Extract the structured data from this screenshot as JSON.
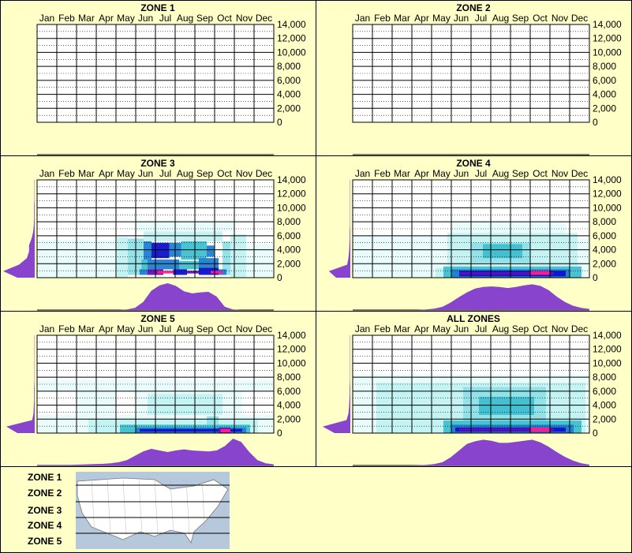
{
  "chart_data": {
    "type": "heatmap",
    "months": [
      "Jan",
      "Feb",
      "Mar",
      "Apr",
      "May",
      "Jun",
      "Jul",
      "Aug",
      "Sep",
      "Oct",
      "Nov",
      "Dec"
    ],
    "y_ticks": [
      "14,000",
      "12,000",
      "10,000",
      "8,000",
      "6,000",
      "4,000",
      "2,000",
      "0"
    ],
    "ylim": [
      0,
      14000
    ],
    "colors": {
      "background": "#ffffc8",
      "plot": "#ffffff",
      "frame": "#000000",
      "marginal": "#8844cc",
      "heat_levels": [
        "#e8fbfb",
        "#c2f2f2",
        "#8fe0e8",
        "#3fbfcf",
        "#1f7fd0",
        "#1010cc",
        "#6010b0",
        "#ff2090"
      ]
    },
    "panels": [
      {
        "title": "ZONE 1",
        "has_data": false,
        "x_marginal": [],
        "y_marginal": [],
        "cells": []
      },
      {
        "title": "ZONE 2",
        "has_data": false,
        "x_marginal": [],
        "y_marginal": [],
        "cells": []
      },
      {
        "title": "ZONE 3",
        "has_data": true,
        "x_marginal": [
          0,
          0,
          0,
          0,
          0,
          0,
          0,
          0,
          0,
          0,
          0,
          0.02,
          0.08,
          0.3,
          0.72,
          0.92,
          1.0,
          0.9,
          0.7,
          0.62,
          0.66,
          0.68,
          0.5,
          0.12,
          0.02,
          0,
          0,
          0,
          0,
          0
        ],
        "y_marginal": [
          0.55,
          1.0,
          0.5,
          0.25,
          0.18,
          0.18,
          0.1,
          0.05,
          0.03,
          0.02,
          0.02,
          0.02,
          0.01,
          0.01,
          0.01,
          0.01
        ],
        "cells": [
          {
            "m": [
              5.2,
              5.6
            ],
            "y": [
              400,
              1200
            ],
            "l": 4
          },
          {
            "m": [
              5.6,
              6.4
            ],
            "y": [
              400,
              1200
            ],
            "l": 6
          },
          {
            "m": [
              6.1,
              6.9
            ],
            "y": [
              600,
              1000
            ],
            "l": 7
          },
          {
            "m": [
              6.9,
              7.6
            ],
            "y": [
              400,
              1200
            ],
            "l": 5
          },
          {
            "m": [
              7.6,
              8.2
            ],
            "y": [
              600,
              1000
            ],
            "l": 6
          },
          {
            "m": [
              8.2,
              9.2
            ],
            "y": [
              400,
              1400
            ],
            "l": 5
          },
          {
            "m": [
              8.8,
              9.4
            ],
            "y": [
              600,
              1000
            ],
            "l": 7
          },
          {
            "m": [
              9.2,
              9.6
            ],
            "y": [
              400,
              1200
            ],
            "l": 4
          },
          {
            "m": [
              5.3,
              5.6
            ],
            "y": [
              1200,
              2600
            ],
            "l": 3
          },
          {
            "m": [
              5.6,
              7.2
            ],
            "y": [
              1200,
              2600
            ],
            "l": 4
          },
          {
            "m": [
              7.2,
              8.2
            ],
            "y": [
              1200,
              2400
            ],
            "l": 3
          },
          {
            "m": [
              8.2,
              9.2
            ],
            "y": [
              1200,
              2800
            ],
            "l": 4
          },
          {
            "m": [
              5.4,
              5.8
            ],
            "y": [
              2600,
              5200
            ],
            "l": 4
          },
          {
            "m": [
              5.8,
              6.7
            ],
            "y": [
              2800,
              5000
            ],
            "l": 5
          },
          {
            "m": [
              6.7,
              7.3
            ],
            "y": [
              3000,
              5000
            ],
            "l": 4
          },
          {
            "m": [
              7.3,
              8.6
            ],
            "y": [
              2600,
              5200
            ],
            "l": 3
          },
          {
            "m": [
              8.6,
              9.0
            ],
            "y": [
              3000,
              4600
            ],
            "l": 4
          },
          {
            "m": [
              4.6,
              5.4
            ],
            "y": [
              400,
              5600
            ],
            "l": 2
          },
          {
            "m": [
              9.4,
              9.8
            ],
            "y": [
              400,
              5200
            ],
            "l": 2
          },
          {
            "m": [
              5.4,
              9.4
            ],
            "y": [
              5200,
              6600
            ],
            "l": 1
          },
          {
            "m": [
              0,
              4.0
            ],
            "y": [
              0,
              5400
            ],
            "l": 0
          },
          {
            "m": [
              4.0,
              4.6
            ],
            "y": [
              0,
              5800
            ],
            "l": 1
          },
          {
            "m": [
              5.0,
              10.0
            ],
            "y": [
              6600,
              8200
            ],
            "l": 0
          },
          {
            "m": [
              9.8,
              10.6
            ],
            "y": [
              0,
              6200
            ],
            "l": 1
          },
          {
            "m": [
              10.6,
              12
            ],
            "y": [
              0,
              4800
            ],
            "l": 0
          }
        ]
      },
      {
        "title": "ZONE 4",
        "has_data": true,
        "x_marginal": [
          0,
          0,
          0,
          0,
          0,
          0,
          0,
          0,
          0,
          0.02,
          0.05,
          0.12,
          0.28,
          0.48,
          0.66,
          0.8,
          0.86,
          0.88,
          0.86,
          0.82,
          0.86,
          0.92,
          0.96,
          0.9,
          0.74,
          0.5,
          0.3,
          0.16,
          0.08,
          0.04
        ],
        "y_marginal": [
          0.45,
          0.68,
          0.1,
          0.06,
          0.04,
          0.03,
          0.02,
          0.02,
          0.01,
          0.01,
          0.01,
          0.01,
          0.01,
          0.01,
          0.01,
          0.01
        ],
        "cells": [
          {
            "m": [
              4.6,
              11.6
            ],
            "y": [
              0,
              1600
            ],
            "l": 3
          },
          {
            "m": [
              4.8,
              11.4
            ],
            "y": [
              1600,
              6400
            ],
            "l": 1
          },
          {
            "m": [
              5.0,
              11.0
            ],
            "y": [
              0,
              1200
            ],
            "l": 4
          },
          {
            "m": [
              5.4,
              10.8
            ],
            "y": [
              200,
              1000
            ],
            "l": 5
          },
          {
            "m": [
              5.4,
              10.2
            ],
            "y": [
              400,
              800
            ],
            "l": 6
          },
          {
            "m": [
              9.0,
              10.0
            ],
            "y": [
              400,
              1000
            ],
            "l": 7
          },
          {
            "m": [
              6.0,
              9.0
            ],
            "y": [
              2200,
              5000
            ],
            "l": 2
          },
          {
            "m": [
              6.6,
              8.6
            ],
            "y": [
              2800,
              4800
            ],
            "l": 3
          },
          {
            "m": [
              3.8,
              4.8
            ],
            "y": [
              0,
              6000
            ],
            "l": 0
          },
          {
            "m": [
              11.4,
              12
            ],
            "y": [
              0,
              5600
            ],
            "l": 0
          },
          {
            "m": [
              5.0,
              10.8
            ],
            "y": [
              6400,
              8000
            ],
            "l": 0
          },
          {
            "m": [
              0,
              3.8
            ],
            "y": [
              0,
              6000
            ],
            "l": 0
          },
          {
            "m": [
              4.2,
              4.6
            ],
            "y": [
              0,
              1400
            ],
            "l": 1
          }
        ]
      },
      {
        "title": "ZONE 5",
        "has_data": true,
        "x_marginal": [
          0.02,
          0.02,
          0.02,
          0.02,
          0.02,
          0.03,
          0.04,
          0.05,
          0.06,
          0.08,
          0.12,
          0.2,
          0.36,
          0.52,
          0.62,
          0.56,
          0.5,
          0.56,
          0.6,
          0.56,
          0.54,
          0.52,
          0.56,
          0.72,
          1.0,
          0.88,
          0.5,
          0.2,
          0.08,
          0.04
        ],
        "y_marginal": [
          0.55,
          0.9,
          0.08,
          0.04,
          0.03,
          0.02,
          0.02,
          0.02,
          0.01,
          0.01,
          0.01,
          0.01,
          0.01,
          0.01,
          0.01,
          0.01
        ],
        "cells": [
          {
            "m": [
              0,
              12
            ],
            "y": [
              0,
              2600
            ],
            "l": 0
          },
          {
            "m": [
              2.6,
              11.2
            ],
            "y": [
              0,
              2000
            ],
            "l": 1
          },
          {
            "m": [
              4.2,
              10.8
            ],
            "y": [
              0,
              1200
            ],
            "l": 3
          },
          {
            "m": [
              5.0,
              10.6
            ],
            "y": [
              0,
              800
            ],
            "l": 4
          },
          {
            "m": [
              5.2,
              10.4
            ],
            "y": [
              200,
              600
            ],
            "l": 5
          },
          {
            "m": [
              9.2,
              9.8
            ],
            "y": [
              0,
              800
            ],
            "l": 6
          },
          {
            "m": [
              9.3,
              9.8
            ],
            "y": [
              100,
              600
            ],
            "l": 7
          },
          {
            "m": [
              5.0,
              10.4
            ],
            "y": [
              2600,
              6000
            ],
            "l": 0
          },
          {
            "m": [
              5.6,
              9.4
            ],
            "y": [
              2600,
              5600
            ],
            "l": 1
          },
          {
            "m": [
              8.6,
              9.2
            ],
            "y": [
              1200,
              2400
            ],
            "l": 2
          },
          {
            "m": [
              2.0,
              4.0
            ],
            "y": [
              2400,
              6000
            ],
            "l": 0
          },
          {
            "m": [
              0,
              12
            ],
            "y": [
              6000,
              7600
            ],
            "l": 0
          }
        ]
      },
      {
        "title": "ALL ZONES",
        "has_data": true,
        "x_marginal": [
          0,
          0,
          0,
          0,
          0,
          0,
          0,
          0,
          0.01,
          0.02,
          0.05,
          0.12,
          0.3,
          0.55,
          0.8,
          0.9,
          0.96,
          0.92,
          0.84,
          0.84,
          0.88,
          0.92,
          0.96,
          0.86,
          0.7,
          0.5,
          0.32,
          0.18,
          0.08,
          0.03
        ],
        "y_marginal": [
          0.5,
          0.88,
          0.12,
          0.06,
          0.04,
          0.03,
          0.02,
          0.02,
          0.01,
          0.01,
          0.01,
          0.01,
          0.01,
          0.01,
          0.01,
          0.01
        ],
        "cells": [
          {
            "m": [
              0,
              12
            ],
            "y": [
              0,
              8400
            ],
            "l": 0
          },
          {
            "m": [
              1.2,
              11.8
            ],
            "y": [
              0,
              7200
            ],
            "l": 1
          },
          {
            "m": [
              4.6,
              11.6
            ],
            "y": [
              0,
              1800
            ],
            "l": 3
          },
          {
            "m": [
              5.0,
              11.2
            ],
            "y": [
              0,
              1200
            ],
            "l": 4
          },
          {
            "m": [
              5.2,
              10.8
            ],
            "y": [
              200,
              800
            ],
            "l": 5
          },
          {
            "m": [
              5.4,
              10.2
            ],
            "y": [
              300,
              700
            ],
            "l": 6
          },
          {
            "m": [
              9.0,
              10.0
            ],
            "y": [
              200,
              800
            ],
            "l": 7
          },
          {
            "m": [
              5.6,
              9.8
            ],
            "y": [
              1800,
              6600
            ],
            "l": 2
          },
          {
            "m": [
              6.4,
              9.2
            ],
            "y": [
              2600,
              5200
            ],
            "l": 3
          },
          {
            "m": [
              7.0,
              8.4
            ],
            "y": [
              3000,
              4600
            ],
            "l": 2
          }
        ]
      }
    ],
    "legend": {
      "zones": [
        "ZONE 1",
        "ZONE 2",
        "ZONE 3",
        "ZONE 4",
        "ZONE 5"
      ]
    }
  }
}
